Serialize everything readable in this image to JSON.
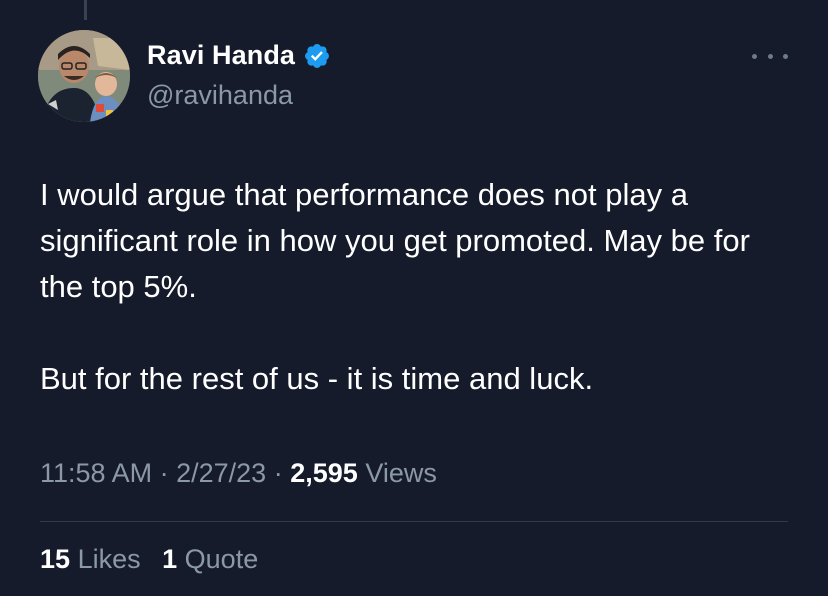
{
  "author": {
    "display_name": "Ravi Handa",
    "handle": "@ravihanda",
    "verified": true
  },
  "tweet": {
    "paragraphs": [
      "I would argue that performance does not play a significant role in how you get promoted. May be for the top 5%.",
      "But for the rest of us - it is time and luck."
    ],
    "time": "11:58 AM",
    "date": "2/27/23",
    "separator": "·",
    "views_count": "2,595",
    "views_label": "Views"
  },
  "stats": {
    "likes_count": "15",
    "likes_label": "Likes",
    "quotes_count": "1",
    "quotes_label": "Quote"
  },
  "colors": {
    "background": "#151b2b",
    "text": "#ffffff",
    "secondary_text": "#8b98a5",
    "verified_blue": "#1d9bf0"
  },
  "icons": {
    "verified": "verified-badge-icon",
    "more": "more-horizontal-icon"
  }
}
